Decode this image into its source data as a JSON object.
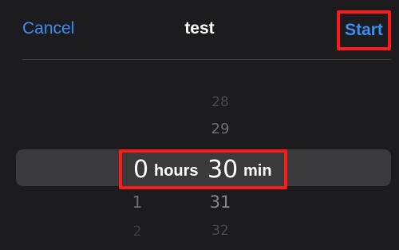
{
  "header": {
    "cancel_label": "Cancel",
    "title": "test",
    "start_label": "Start"
  },
  "picker": {
    "hours": {
      "unit": "hours",
      "selected": "0",
      "below": [
        "1",
        "2"
      ]
    },
    "minutes": {
      "unit": "min",
      "selected": "30",
      "above": [
        "28",
        "29"
      ],
      "below": [
        "31",
        "32"
      ]
    }
  },
  "colors": {
    "accent": "#3a8ef6",
    "background": "#1c1c1e",
    "selection_band": "#3a3a3c",
    "highlight_box": "#ff1a1a"
  }
}
